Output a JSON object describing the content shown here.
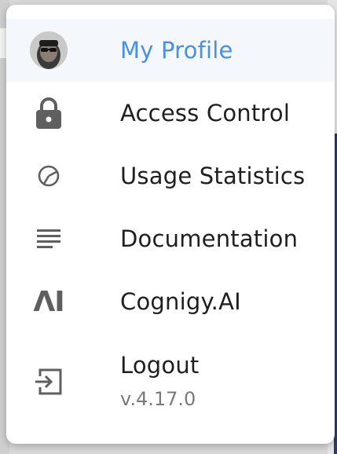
{
  "menu": {
    "items": [
      {
        "label": "My Profile",
        "icon": "avatar",
        "active": true
      },
      {
        "label": "Access Control",
        "icon": "lock-icon"
      },
      {
        "label": "Usage Statistics",
        "icon": "pie-chart-icon"
      },
      {
        "label": "Documentation",
        "icon": "lines-document-icon"
      },
      {
        "label": "Cognigy.AI",
        "icon": "ai-logo-icon",
        "glyph": "ΛI"
      },
      {
        "label": "Logout",
        "icon": "logout-icon",
        "version": "v.4.17.0"
      }
    ],
    "colors": {
      "active_text": "#4a90e2",
      "active_bg": "#f4f7fb",
      "text": "#1f1f1f",
      "icon": "#5f5f5f",
      "version": "#7a7a7a"
    }
  }
}
